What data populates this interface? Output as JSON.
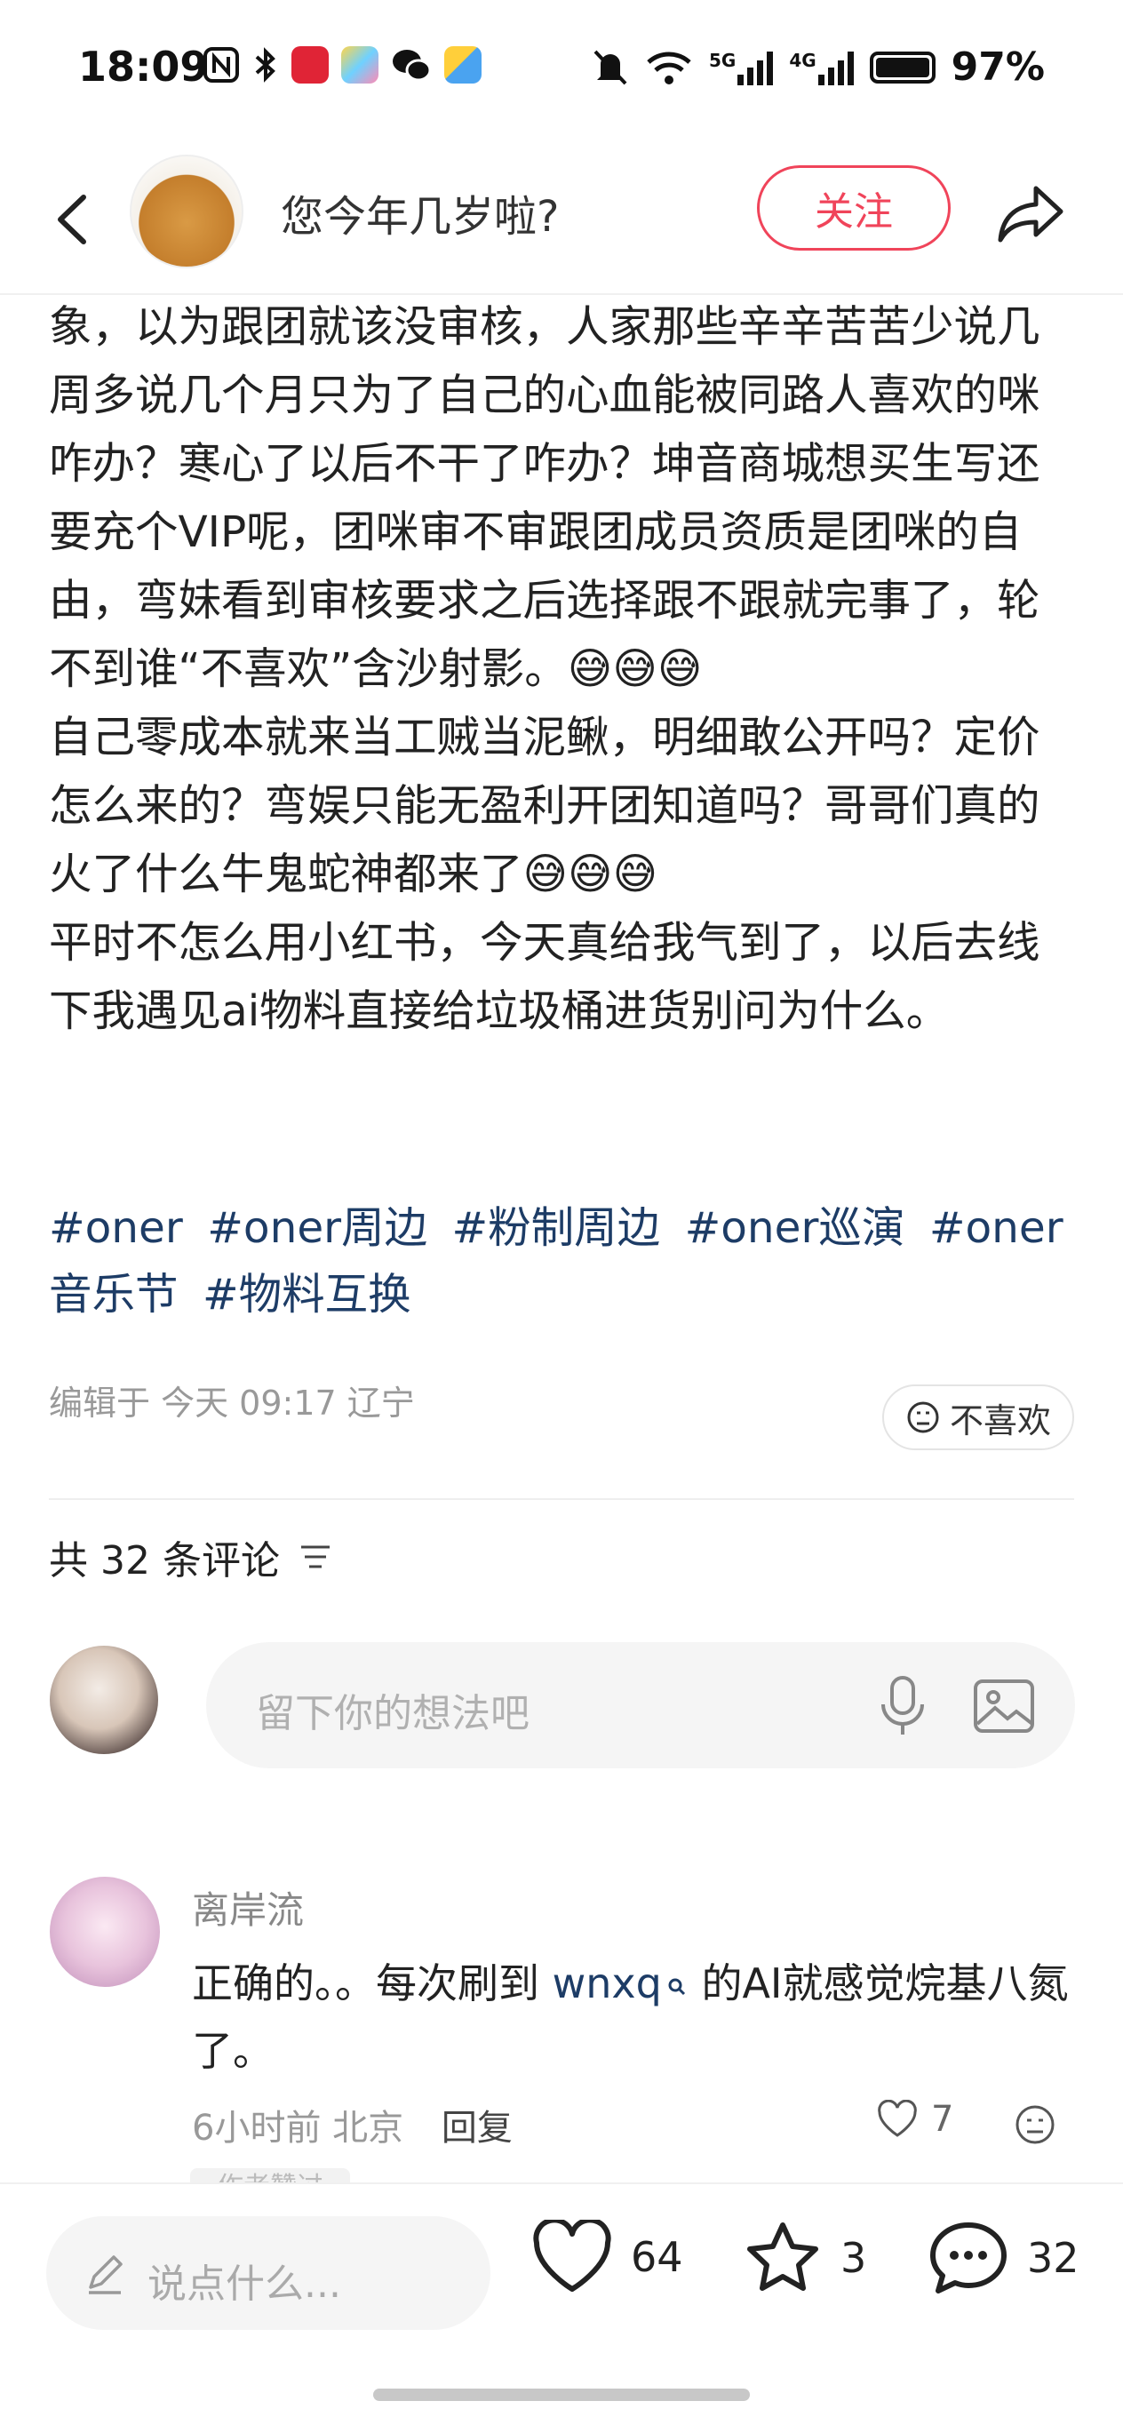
{
  "status_bar": {
    "time": "18:09",
    "battery": "97%",
    "network_labels": [
      "5G",
      "4G"
    ],
    "left_icons": [
      "nfc-icon",
      "bluetooth-icon",
      "shop-app-icon",
      "gallery-app-icon",
      "wechat-icon",
      "weather-icon"
    ],
    "right_icons": [
      "mute-bell-icon",
      "wifi-icon",
      "signal-5g-icon",
      "signal-4g-icon",
      "battery-icon"
    ]
  },
  "header": {
    "author_name": "您今年几岁啦?",
    "follow_label": "关注"
  },
  "post": {
    "paragraphs": [
      "象，以为跟团就该没审核，人家那些辛辛苦苦少说几周多说几个月只为了自己的心血能被同路人喜欢的咪咋办？寒心了以后不干了咋办？坤音商城想买生写还要充个VIP呢，团咪审不审跟团成员资质是团咪的自由，弯妹看到审核要求之后选择跟不跟就完事了，轮不到谁“不喜欢”含沙射影。😅😅😅",
      "自己零成本就来当工贼当泥鳅，明细敢公开吗？定价怎么来的？弯娱只能无盈利开团知道吗？哥哥们真的火了什么牛鬼蛇神都来了😅😅😅",
      "平时不怎么用小红书，今天真给我气到了，以后去线下我遇见ai物料直接给垃圾桶进货别问为什么。"
    ],
    "hashtags": [
      "#oner",
      "#oner周边",
      "#粉制周边",
      "#oner巡演",
      "#oner音乐节",
      "#物料互换"
    ],
    "meta": "编辑于 今天 09:17 辽宁",
    "dislike_label": "不喜欢"
  },
  "comments": {
    "title": "共 32 条评论",
    "input_placeholder": "留下你的想法吧",
    "items": [
      {
        "username": "离岸流",
        "text_before": "正确的。。每次刷到 ",
        "link_text": "wnxq",
        "text_after": " 的AI就感觉烷基八氮了。",
        "time": "6小时前",
        "location": "北京",
        "reply_label": "回复",
        "likes": "7",
        "badge": "作者赞过"
      }
    ]
  },
  "bottom_bar": {
    "input_placeholder": "说点什么...",
    "likes": "64",
    "collects": "3",
    "comments": "32"
  }
}
